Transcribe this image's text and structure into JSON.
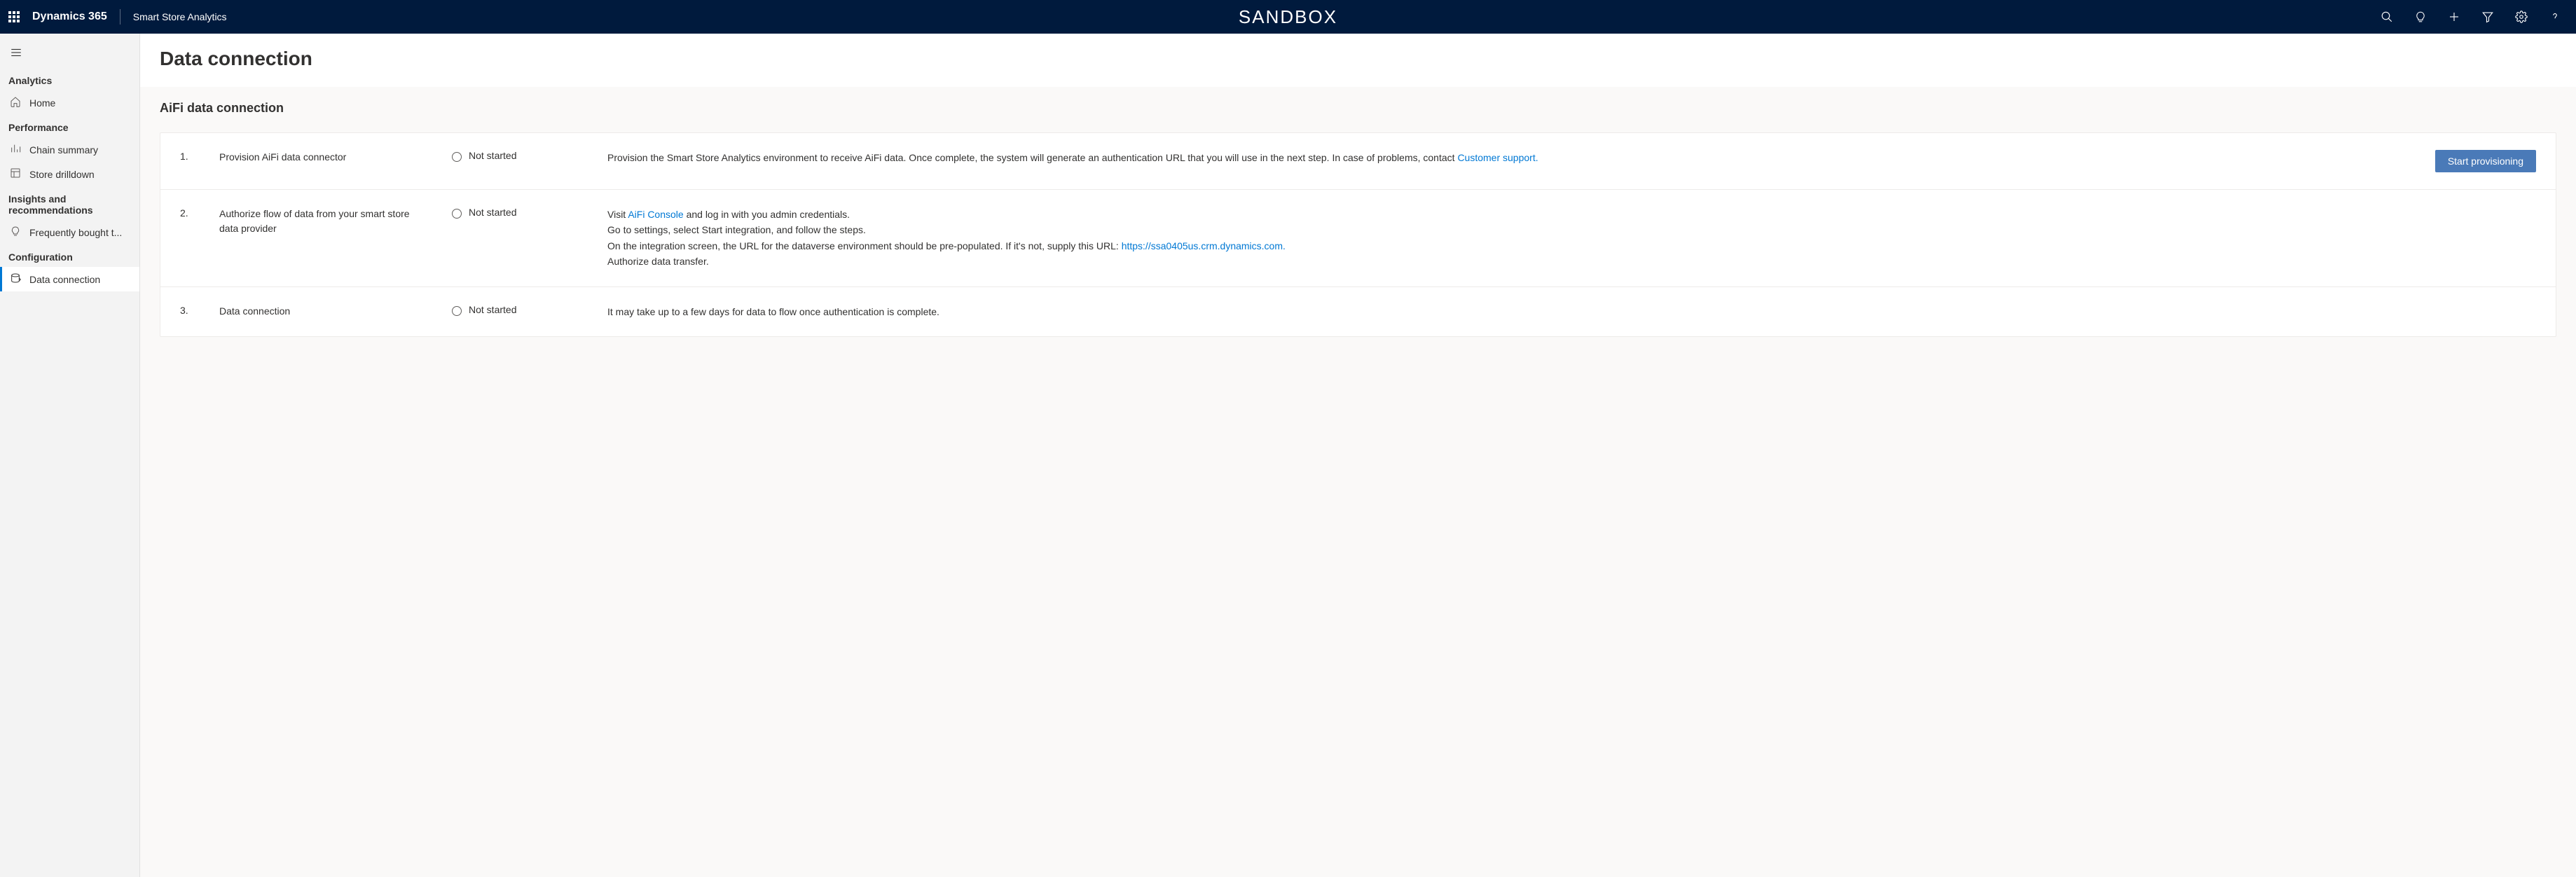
{
  "header": {
    "brand": "Dynamics 365",
    "app_name": "Smart Store Analytics",
    "environment_label": "SANDBOX"
  },
  "sidebar": {
    "sections": [
      {
        "label": "Analytics",
        "items": [
          {
            "icon": "home",
            "label": "Home"
          }
        ]
      },
      {
        "label": "Performance",
        "items": [
          {
            "icon": "chart",
            "label": "Chain summary"
          },
          {
            "icon": "store",
            "label": "Store drilldown"
          }
        ]
      },
      {
        "label": "Insights and recommendations",
        "items": [
          {
            "icon": "bulb",
            "label": "Frequently bought t..."
          }
        ]
      },
      {
        "label": "Configuration",
        "items": [
          {
            "icon": "dataconn",
            "label": "Data connection",
            "active": true
          }
        ]
      }
    ]
  },
  "page": {
    "title": "Data connection",
    "section_title": "AiFi data connection",
    "steps": [
      {
        "num": "1.",
        "title": "Provision AiFi data connector",
        "status": "Not started",
        "desc_parts": [
          {
            "text": "Provision the Smart Store Analytics environment to receive AiFi data. Once complete, the system will generate an authentication URL that you will use in the next step. In case of problems, contact "
          },
          {
            "text": "Customer support.",
            "link": true
          }
        ],
        "action_label": "Start provisioning"
      },
      {
        "num": "2.",
        "title": "Authorize flow of data from your smart store data provider",
        "status": "Not started",
        "desc_parts": [
          {
            "text": "Visit "
          },
          {
            "text": "AiFi Console",
            "link": true
          },
          {
            "text": " and log in with you admin credentials."
          },
          {
            "br": true
          },
          {
            "text": "Go to settings, select Start integration, and follow the steps."
          },
          {
            "br": true
          },
          {
            "text": "On the integration screen, the URL for the dataverse environment should be pre-populated. If it's not, supply this URL: "
          },
          {
            "text": "https://ssa0405us.crm.dynamics.com.",
            "link": true
          },
          {
            "br": true
          },
          {
            "text": "Authorize data transfer."
          }
        ]
      },
      {
        "num": "3.",
        "title": "Data connection",
        "status": "Not started",
        "desc_parts": [
          {
            "text": "It may take up to a few days for data to flow once authentication is complete."
          }
        ]
      }
    ]
  }
}
